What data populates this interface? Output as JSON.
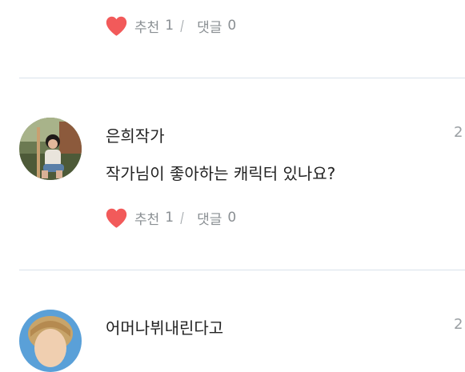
{
  "comments": [
    {
      "recommend_label": "추천",
      "recommend_count": "1",
      "reply_label": "댓글",
      "reply_count": "0"
    },
    {
      "author": "은희작가",
      "text": "작가님이 좋아하는 캐릭터 있나요?",
      "time": "2",
      "recommend_label": "추천",
      "recommend_count": "1",
      "reply_label": "댓글",
      "reply_count": "0"
    },
    {
      "author": "어머나뷔내린다고",
      "time": "2"
    }
  ],
  "colors": {
    "heart": "#f25a5a",
    "divider": "#d9e3ea",
    "muted_text": "#8a8f93"
  },
  "icons": {
    "recommend": "heart-icon"
  }
}
